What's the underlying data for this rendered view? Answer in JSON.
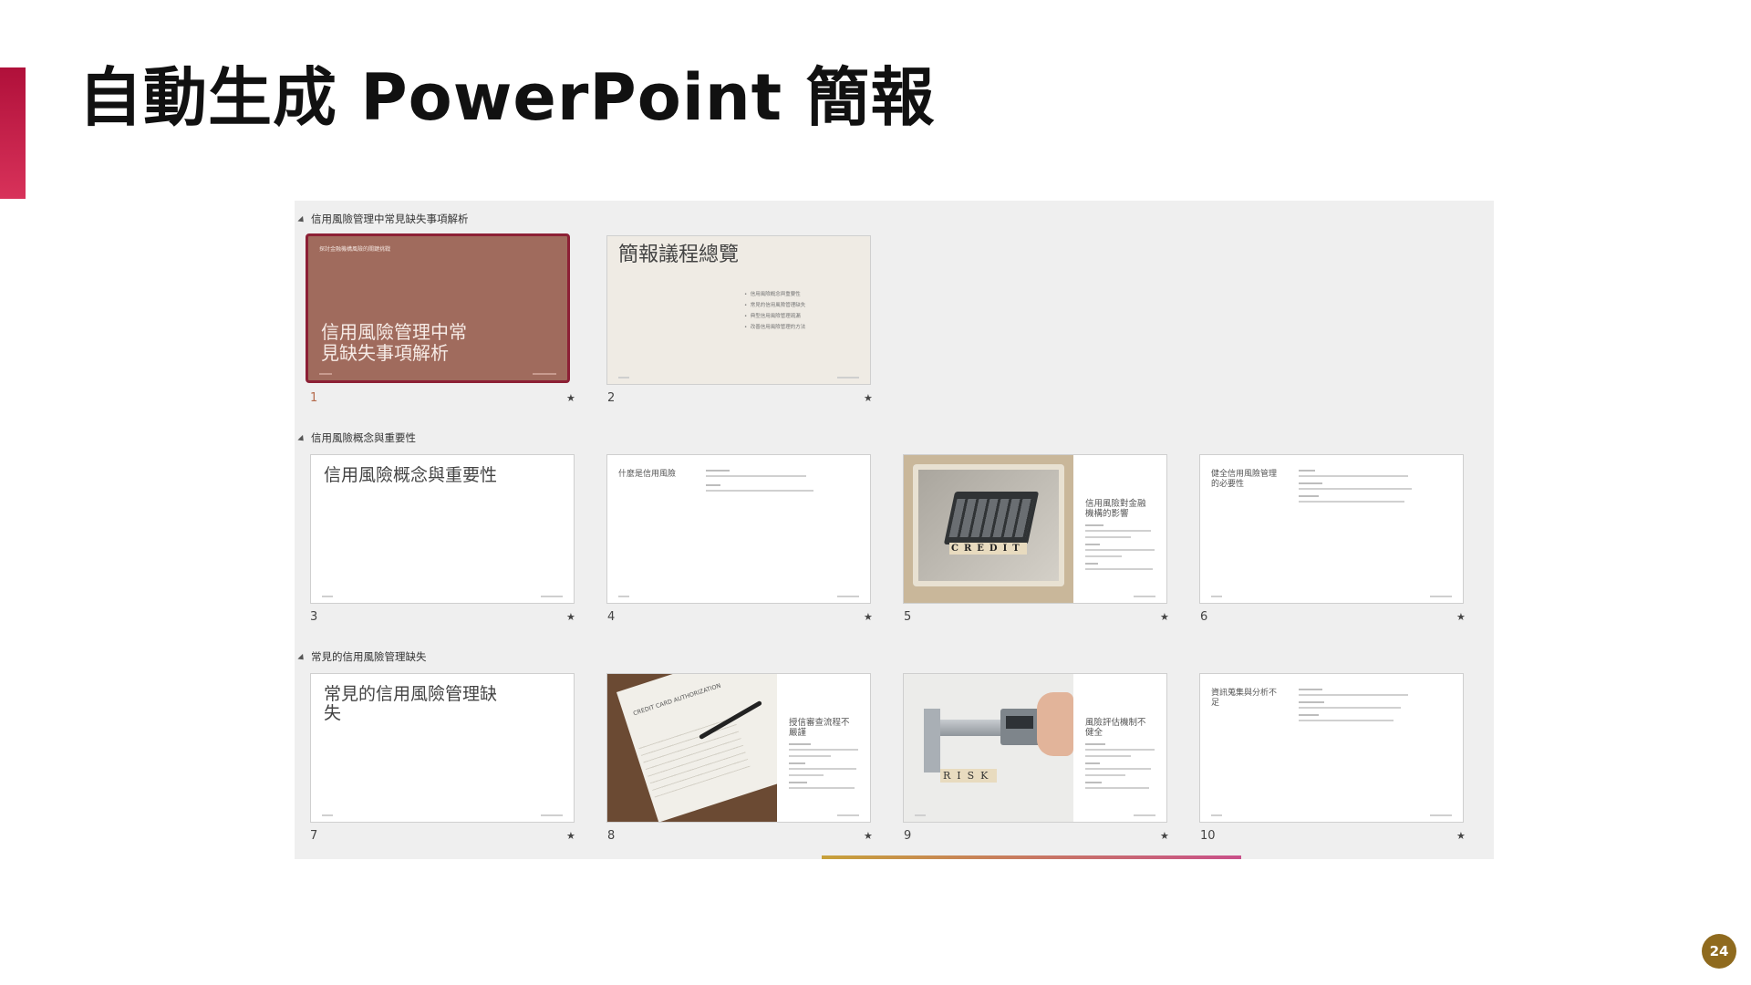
{
  "page": {
    "title": "自動生成 PowerPoint 簡報",
    "page_number": "24",
    "accent_color": "#c0183f",
    "badge_color": "#8f6a1e"
  },
  "slide_sorter": {
    "sections": [
      {
        "label": "信用風險管理中常見缺失事項解析"
      },
      {
        "label": "信用風險概念與重要性"
      },
      {
        "label": "常見的信用風險管理缺失"
      }
    ],
    "slides": [
      {
        "num": "1",
        "title": "信用風險管理中常\n見缺失事項解析",
        "subtitle": "探討金融機構風險的關鍵挑戰",
        "bg": "#a06b5d",
        "selected": true
      },
      {
        "num": "2",
        "title": "簡報議程總覽",
        "bullets": [
          "信用風險概念與重要性",
          "常見的信用風險管理缺失",
          "典型信用風險管理疏漏",
          "改善信用風險管理的方法"
        ]
      },
      {
        "num": "3",
        "title": "信用風險概念與重要性"
      },
      {
        "num": "4",
        "title": "什麼是信用風險"
      },
      {
        "num": "5",
        "title": "信用風險對金融\n機構的影響",
        "image_word": "CREDIT"
      },
      {
        "num": "6",
        "title": "健全信用風險管理\n的必要性"
      },
      {
        "num": "7",
        "title": "常見的信用風險管理缺\n失"
      },
      {
        "num": "8",
        "title": "授信審查流程不\n嚴謹",
        "image_word": "CREDIT CARD AUTHORIZATION"
      },
      {
        "num": "9",
        "title": "風險評估機制不\n健全",
        "image_word": "RISK"
      },
      {
        "num": "10",
        "title": "資訊蒐集與分析不\n足"
      }
    ]
  }
}
